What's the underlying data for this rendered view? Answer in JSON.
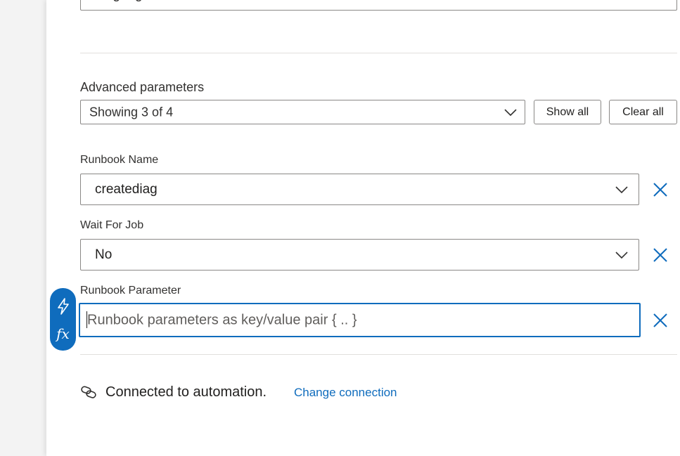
{
  "top_field": {
    "value": "diagnogistic-create"
  },
  "advanced": {
    "label": "Advanced parameters",
    "selected": "Showing 3 of 4",
    "show_all_label": "Show all",
    "clear_all_label": "Clear all"
  },
  "params": [
    {
      "label": "Runbook Name",
      "value": "creatediag"
    },
    {
      "label": "Wait For Job",
      "value": "No"
    },
    {
      "label": "Runbook Parameter",
      "placeholder": "Runbook parameters as key/value pair { .. }"
    }
  ],
  "dynamic_content": {
    "fx_label": "fx"
  },
  "connection": {
    "status": "Connected to automation.",
    "change_label": "Change connection"
  },
  "colors": {
    "accent": "#0f6cbd",
    "border": "#8a8886"
  }
}
